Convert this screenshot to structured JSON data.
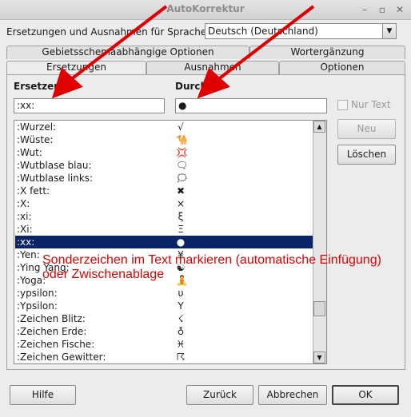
{
  "window": {
    "title": "AutoKorrektur"
  },
  "language": {
    "label": "Ersetzungen und Ausnahmen für Sprache:",
    "selected": "Deutsch (Deutschland)"
  },
  "tabs_back": [
    "Gebietsschemaabhängige Optionen",
    "Wortergänzung"
  ],
  "tabs_front": [
    "Ersetzungen",
    "Ausnahmen",
    "Optionen"
  ],
  "replace": {
    "header": "Ersetzen",
    "with_header": "Durch",
    "replace_value": ":xx:",
    "with_value": "●",
    "text_only_label": "Nur Text"
  },
  "entries": [
    {
      "key": ":Wurzel:",
      "value": "√"
    },
    {
      "key": ":Wüste:",
      "value": "🐪"
    },
    {
      "key": ":Wut:",
      "value": "💢"
    },
    {
      "key": ":Wutblase blau:",
      "value": "🗨"
    },
    {
      "key": ":Wutblase links:",
      "value": "🗯"
    },
    {
      "key": ":X fett:",
      "value": "✖"
    },
    {
      "key": ":X:",
      "value": "×"
    },
    {
      "key": ":xi:",
      "value": "ξ"
    },
    {
      "key": ":Xi:",
      "value": "Ξ"
    },
    {
      "key": ":xx:",
      "value": "●",
      "selected": true
    },
    {
      "key": ":Yen:",
      "value": "¥"
    },
    {
      "key": ":Ying Yang:",
      "value": "☯"
    },
    {
      "key": ":Yoga:",
      "value": "🧘"
    },
    {
      "key": ":ypsilon:",
      "value": "υ"
    },
    {
      "key": ":Ypsilon:",
      "value": "Υ"
    },
    {
      "key": ":Zeichen Blitz:",
      "value": "☇"
    },
    {
      "key": ":Zeichen Erde:",
      "value": "♁"
    },
    {
      "key": ":Zeichen Fische:",
      "value": "♓"
    },
    {
      "key": ":Zeichen Gewitter:",
      "value": "☈"
    }
  ],
  "side_buttons": {
    "new": "Neu",
    "delete": "Löschen"
  },
  "annotation": {
    "line1": "Sonderzeichen im Text markieren (automatische Einfügung)",
    "line2": "oder Zwischenablage"
  },
  "footer": {
    "help": "Hilfe",
    "back": "Zurück",
    "cancel": "Abbrechen",
    "ok": "OK"
  },
  "colors": {
    "selection": "#0a246a",
    "annotation": "#e00000"
  }
}
